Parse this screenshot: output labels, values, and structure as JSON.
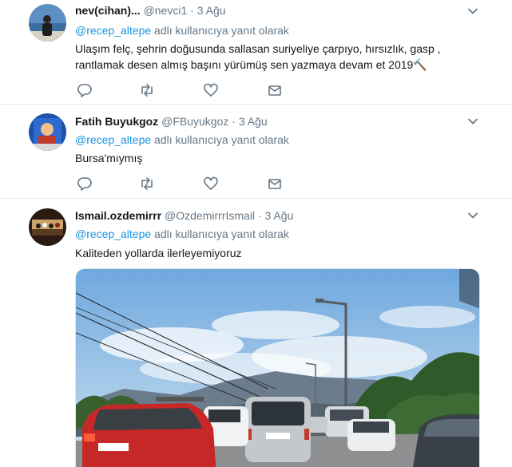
{
  "tweets": [
    {
      "name": "nev(cihan)...",
      "handle": "@nevci1",
      "time": "3 Ağu",
      "reply_mention": "@recep_altepe",
      "reply_suffix": " adlı kullanıcıya yanıt olarak",
      "text": "Ulaşım felç, şehrin doğusunda sallasan suriyeliye çarpıyo, hırsızlık, gasp , rantlamak desen almış başını yürümüş sen yazmaya devam et 2019🔨"
    },
    {
      "name": "Fatih Buyukgoz",
      "handle": "@FBuyukgoz",
      "time": "3 Ağu",
      "reply_mention": "@recep_altepe",
      "reply_suffix": " adlı kullanıcıya yanıt olarak",
      "text": "Bursa'mıymış"
    },
    {
      "name": "Ismail.ozdemirrr",
      "handle": "@OzdemirrrIsmail",
      "time": "3 Ağu",
      "reply_mention": "@recep_altepe",
      "reply_suffix": " adlı kullanıcıya yanıt olarak",
      "text": "Kaliteden yollarda ilerleyemiyoruz"
    }
  ],
  "separator": " · ",
  "colors": {
    "link": "#1b95e0",
    "muted": "#657786",
    "text": "#14171a",
    "border": "#e6ecf0"
  },
  "icons": [
    "reply-icon",
    "retweet-icon",
    "like-icon",
    "direct-message-icon",
    "chevron-down-icon"
  ]
}
